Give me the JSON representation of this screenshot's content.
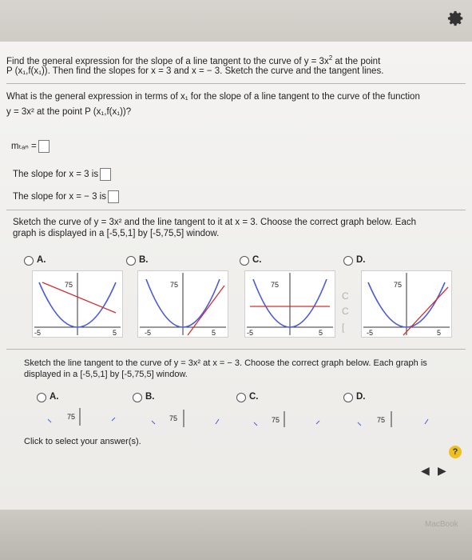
{
  "q1": {
    "line1": "Find the general expression for the slope of a line tangent to the curve of y = 3x",
    "exp1": "2",
    "line1b": " at the point",
    "line2": "P (x₁,f(x₁)). Then find the slopes for x = 3 and x = − 3. Sketch the curve and the tangent lines."
  },
  "q2": {
    "line1": "What is the general expression in terms of x₁ for the slope of a line tangent to the curve of the function",
    "line2": "y = 3x² at the point P (x₁,f(x₁))?"
  },
  "mtan": "mₜₐₙ =",
  "slope3": "The slope for x = 3 is",
  "slopeneg3": "The slope for x = − 3 is",
  "sketch1": {
    "line1": "Sketch the curve of y = 3x² and the line tangent to it at x = 3. Choose the correct graph below. Each",
    "line2": "graph is displayed in a [-5,5,1] by [-5,75,5] window."
  },
  "options": [
    "A.",
    "B.",
    "C.",
    "D."
  ],
  "ytick": "75",
  "xlow": "-5",
  "xhigh": "5",
  "sketch2": {
    "line1": "Sketch the line tangent to the curve of y = 3x² at x = − 3. Choose the correct graph below. Each graph is",
    "line2": "displayed in a [-5,5,1] by [-5,75,5] window."
  },
  "click": "Click to select your answer(s).",
  "help": "?",
  "watermark": "MacBook",
  "colors": {
    "curve": "#4a5bd8",
    "tangent": "#d23030"
  }
}
